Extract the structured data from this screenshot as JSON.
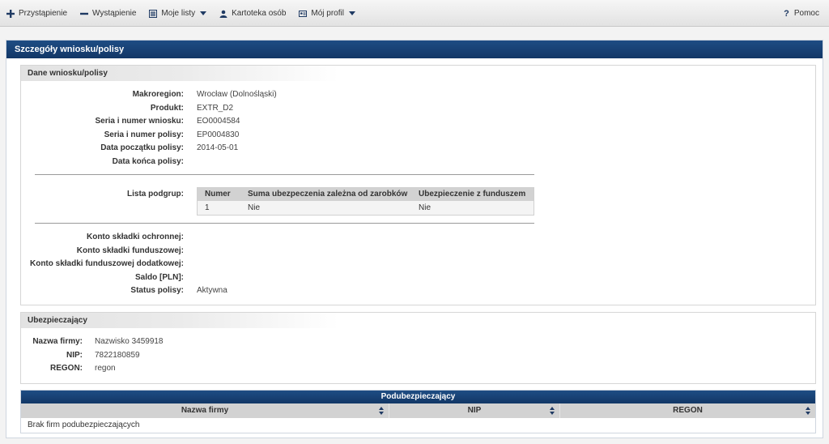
{
  "menu": {
    "items": [
      {
        "label": "Przystąpienie",
        "icon": "plus-icon"
      },
      {
        "label": "Wystąpienie",
        "icon": "minus-icon"
      },
      {
        "label": "Moje listy",
        "icon": "list-icon"
      },
      {
        "label": "Kartoteka osób",
        "icon": "person-icon"
      },
      {
        "label": "Mój profil",
        "icon": "profile-card-icon"
      }
    ],
    "help": "Pomoc"
  },
  "panel": {
    "title": "Szczegóły wniosku/polisy"
  },
  "policy": {
    "title": "Dane wniosku/polisy",
    "fields": [
      {
        "label": "Makroregion:",
        "value": "Wrocław (Dolnośląski)"
      },
      {
        "label": "Produkt:",
        "value": "EXTR_D2"
      },
      {
        "label": "Seria i numer wniosku:",
        "value": "EO0004584"
      },
      {
        "label": "Seria i numer polisy:",
        "value": "EP0004830"
      },
      {
        "label": "Data początku polisy:",
        "value": "2014-05-01"
      },
      {
        "label": "Data końca polisy:",
        "value": ""
      }
    ],
    "subgroups_label": "Lista podgrup:",
    "subgroups": {
      "headers": [
        "Numer",
        "Suma ubezpeczenia zależna od zarobków",
        "Ubezpieczenie z funduszem"
      ],
      "rows": [
        [
          "1",
          "Nie",
          "Nie"
        ]
      ]
    },
    "accounts": [
      {
        "label": "Konto składki ochronnej:",
        "value": ""
      },
      {
        "label": "Konto składki funduszowej:",
        "value": ""
      },
      {
        "label": "Konto składki funduszowej dodatkowej:",
        "value": ""
      },
      {
        "label": "Saldo [PLN]:",
        "value": ""
      },
      {
        "label": "Status polisy:",
        "value": "Aktywna"
      }
    ]
  },
  "insurer": {
    "title": "Ubezpieczający",
    "fields": [
      {
        "label": "Nazwa firmy:",
        "value": "Nazwisko 3459918"
      },
      {
        "label": "NIP:",
        "value": "7822180859"
      },
      {
        "label": "REGON:",
        "value": "regon"
      }
    ]
  },
  "co_insured": {
    "title": "Podubezpieczający",
    "columns": [
      "Nazwa firmy",
      "NIP",
      "REGON"
    ],
    "empty_text": "Brak firm podubezpieczających"
  },
  "colors": {
    "header_blue": "#1a4276",
    "accent": "#1f3a63"
  }
}
